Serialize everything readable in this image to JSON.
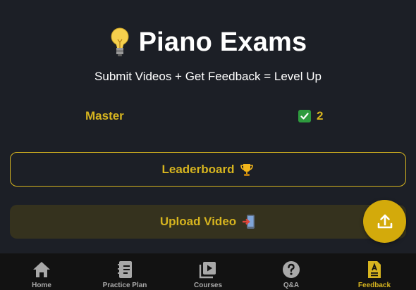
{
  "header": {
    "title": "Piano Exams",
    "subtitle": "Submit Videos + Get Feedback = Level Up",
    "icon": "lightbulb-icon"
  },
  "level": {
    "name": "Master",
    "count": "2",
    "count_icon": "check-mark-icon"
  },
  "buttons": {
    "leaderboard_label": "Leaderboard",
    "leaderboard_icon": "trophy-icon",
    "upload_label": "Upload Video",
    "upload_icon": "mobile-phone-arrow-icon",
    "fab_icon": "upload-icon"
  },
  "nav": {
    "items": [
      {
        "label": "Home",
        "icon": "home-icon",
        "active": false
      },
      {
        "label": "Practice Plan",
        "icon": "notebook-icon",
        "active": false
      },
      {
        "label": "Courses",
        "icon": "video-library-icon",
        "active": false
      },
      {
        "label": "Q&A",
        "icon": "question-icon",
        "active": false
      },
      {
        "label": "Feedback",
        "icon": "graded-document-icon",
        "active": true
      }
    ]
  },
  "colors": {
    "background": "#1c1f26",
    "accent": "#d6b41f",
    "fab": "#d3aa0b",
    "nav_background": "#121212",
    "nav_inactive": "#a8a8a8"
  }
}
